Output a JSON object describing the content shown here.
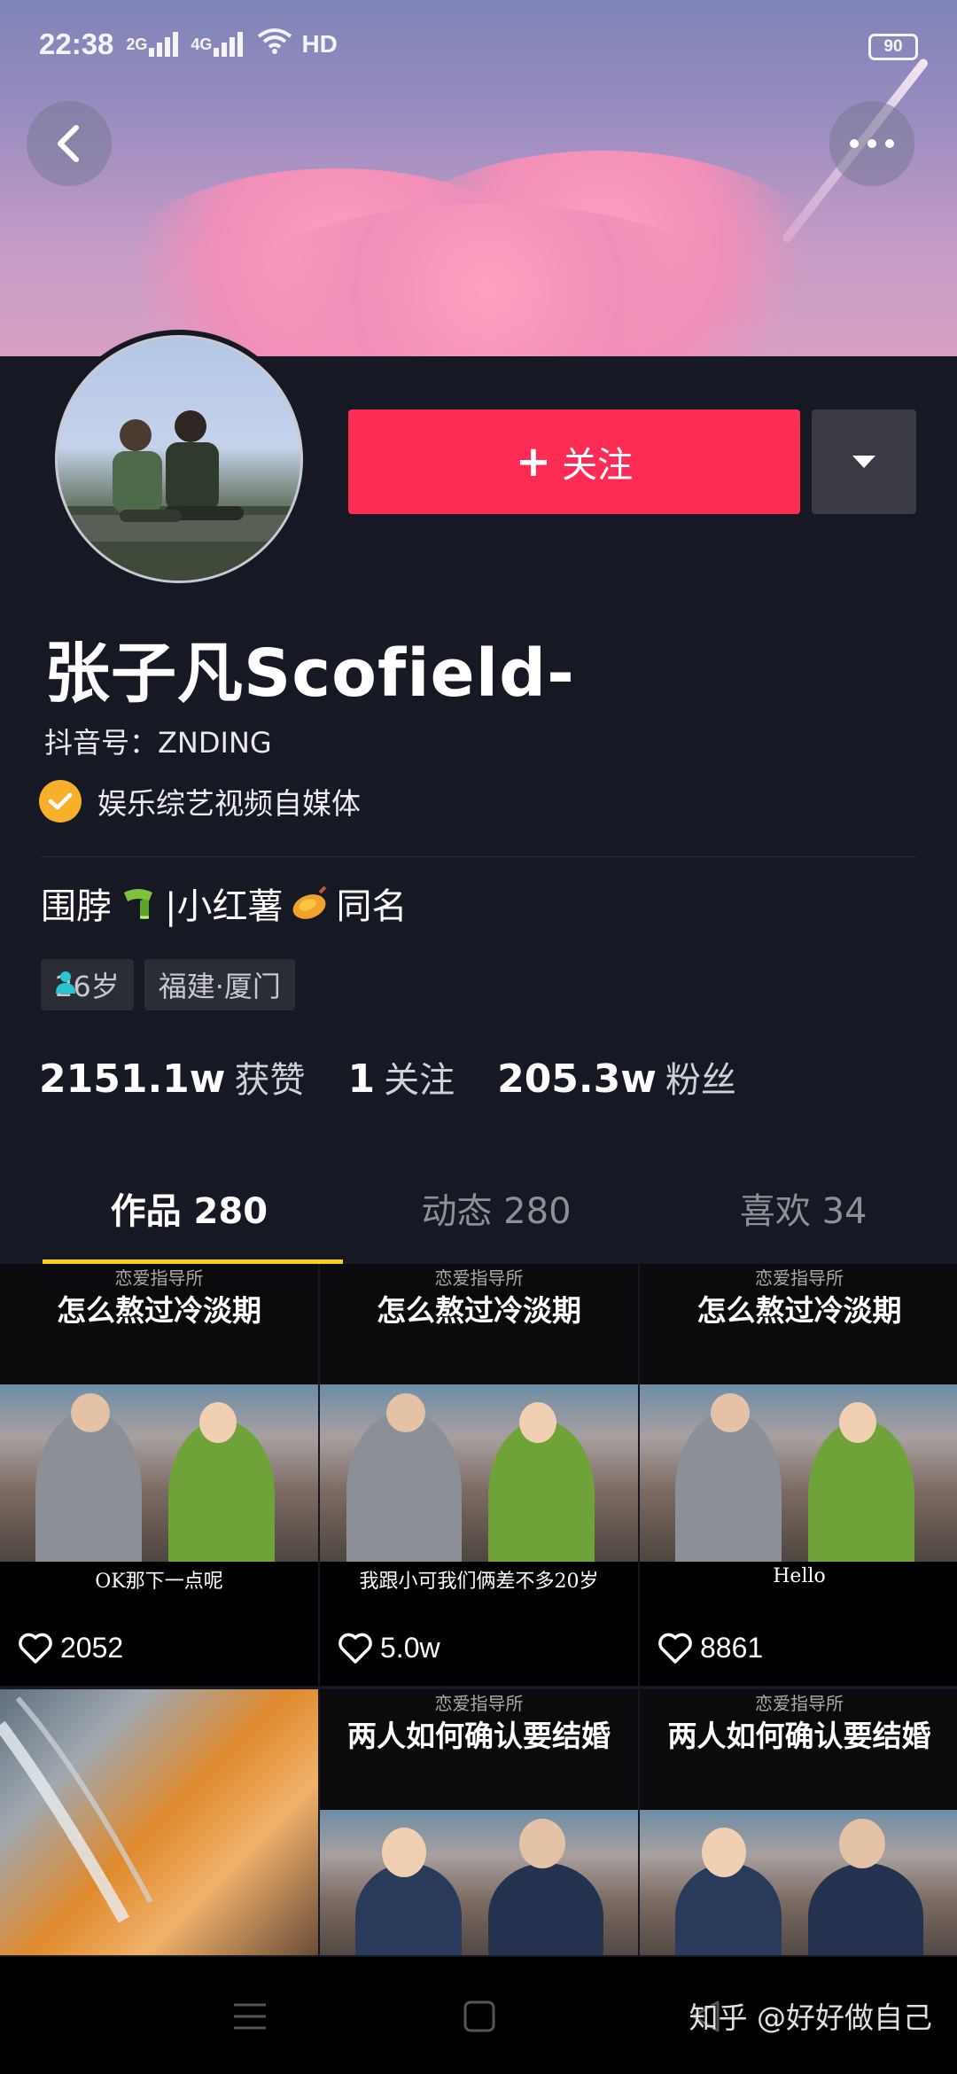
{
  "status": {
    "time": "22:38",
    "sig1": "2G",
    "sig2": "4G",
    "hd": "HD",
    "battery": "90"
  },
  "profile": {
    "follow_label": "关注",
    "name": "张子凡Scofield-",
    "douyin_id": "抖音号：ZNDING",
    "verified_text": "娱乐综艺视频自媒体",
    "bio_part1": "围脖",
    "bio_part2": "|小红薯",
    "bio_part3": "同名",
    "tag_age": "26岁",
    "tag_location": "福建·厦门",
    "likes_num": "2151.1w",
    "likes_label": "获赞",
    "following_num": "1",
    "following_label": "关注",
    "fans_num": "205.3w",
    "fans_label": "粉丝"
  },
  "tabs": [
    {
      "label": "作品 280",
      "active": true
    },
    {
      "label": "动态 280",
      "active": false
    },
    {
      "label": "喜欢 34",
      "active": false
    }
  ],
  "videos": [
    {
      "header": "恋爱指导所",
      "title": "怎么熬过冷淡期",
      "subtitle": "OK那下一点呢",
      "likes": "2052"
    },
    {
      "header": "恋爱指导所",
      "title": "怎么熬过冷淡期",
      "subtitle": "我跟小可我们俩差不多20岁",
      "likes": "5.0w"
    },
    {
      "header": "恋爱指导所",
      "title": "怎么熬过冷淡期",
      "subtitle": "Hello",
      "likes": "8861"
    },
    {
      "header": "",
      "title": "",
      "subtitle": "",
      "likes": ""
    },
    {
      "header": "恋爱指导所",
      "title": "两人如何确认要结婚",
      "subtitle": "",
      "likes": ""
    },
    {
      "header": "恋爱指导所",
      "title": "两人如何确认要结婚",
      "subtitle": "",
      "likes": ""
    }
  ],
  "watermark": "知乎 @好好做自己"
}
